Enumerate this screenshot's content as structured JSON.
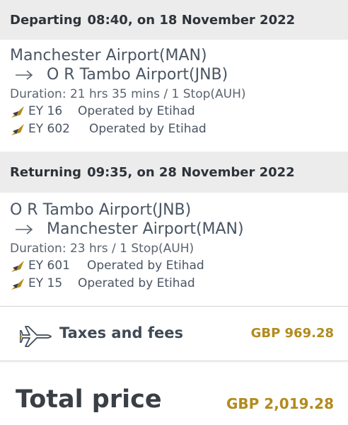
{
  "departing": {
    "label": "Departing",
    "when": "08:40, on 18 November 2022",
    "origin": "Manchester Airport(MAN)",
    "destination": "O R Tambo Airport(JNB)",
    "duration": "Duration: 21 hrs 35 mins / 1 Stop(AUH)",
    "flights": [
      {
        "number": "EY 16",
        "operator": "Operated by Etihad"
      },
      {
        "number": "EY 602",
        "operator": "Operated by Etihad"
      }
    ]
  },
  "returning": {
    "label": "Returning",
    "when": "09:35, on 28 November 2022",
    "origin": "O R Tambo Airport(JNB)",
    "destination": "Manchester Airport(MAN)",
    "duration": "Duration: 23 hrs  / 1 Stop(AUH)",
    "flights": [
      {
        "number": "EY 601",
        "operator": "Operated by Etihad"
      },
      {
        "number": "EY 15",
        "operator": "Operated by Etihad"
      }
    ]
  },
  "taxes": {
    "label": "Taxes and fees",
    "amount": "GBP 969.28",
    "icon": "plane-icon"
  },
  "total": {
    "label": "Total price",
    "amount": "GBP 2,019.28"
  },
  "colors": {
    "accent": "#b28b1d",
    "header_bg": "#ececec",
    "text": "#4a5563"
  }
}
